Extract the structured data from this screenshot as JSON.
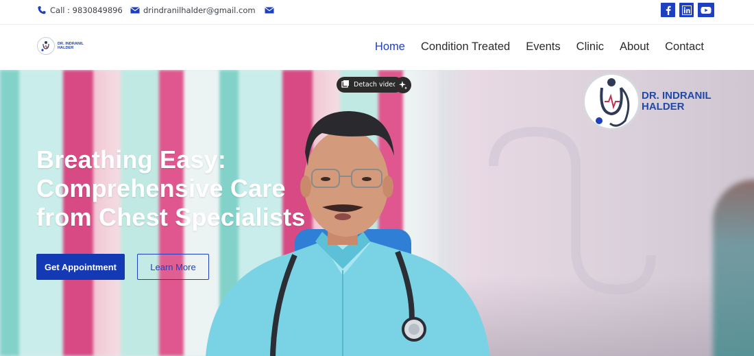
{
  "topbar": {
    "phone": "Call : 9830849896",
    "email": "drindranilhalder@gmail.com",
    "social": [
      "facebook",
      "linkedin",
      "youtube"
    ]
  },
  "logo": {
    "line1": "DR. INDRANIL",
    "line2": "HALDER"
  },
  "nav": {
    "items": [
      {
        "label": "Home",
        "active": true
      },
      {
        "label": "Condition Treated",
        "active": false
      },
      {
        "label": "Events",
        "active": false
      },
      {
        "label": "Clinic",
        "active": false
      },
      {
        "label": "About",
        "active": false
      },
      {
        "label": "Contact",
        "active": false
      }
    ]
  },
  "hero": {
    "title_line1": "Breathing Easy:",
    "title_line2": "Comprehensive Care",
    "title_line3": "from Chest Specialists",
    "primary_button": "Get Appointment",
    "secondary_button": "Learn More"
  },
  "video": {
    "detach_label": "Detach video",
    "watermark_line1": "DR. INDRANIL",
    "watermark_line2": "HALDER"
  },
  "colors": {
    "brand_blue": "#1e3fbf",
    "button_blue": "#1439b5",
    "white": "#ffffff"
  },
  "icons": [
    "phone-icon",
    "mail-icon",
    "mail-icon",
    "facebook-icon",
    "linkedin-icon",
    "youtube-icon",
    "detach-icon",
    "sparkle-icon",
    "stethoscope-logo-icon"
  ]
}
